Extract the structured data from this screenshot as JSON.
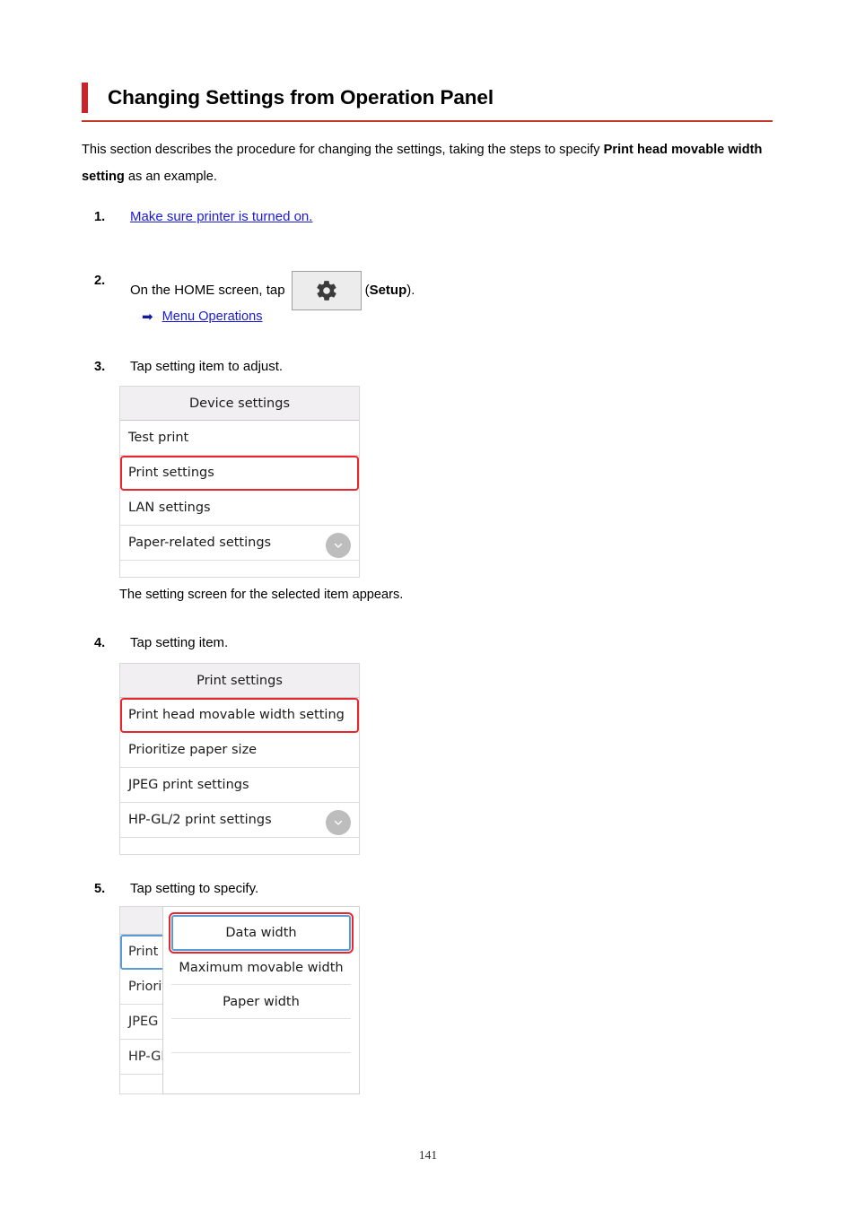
{
  "document": {
    "title": "Changing Settings from Operation Panel",
    "accent_color": "#cc2229",
    "rule_color": "#c0392b",
    "intro": {
      "part1": "This section describes the procedure for changing the settings, taking the steps to specify ",
      "bold1": "Print head movable width setting",
      "part2": " as an example."
    },
    "page_number": "141"
  },
  "steps": {
    "step1": {
      "number": "1.",
      "link_text": "Make sure printer is turned on."
    },
    "step2": {
      "number": "2.",
      "text_before": "On the HOME screen, tap",
      "icon_name": "gear-icon",
      "text_after_open": "(",
      "bold_label": "Setup",
      "text_after_close": ").",
      "sub_link": "Menu Operations",
      "sub_link_arrow": "➡"
    },
    "step3": {
      "number": "3.",
      "text": "Tap setting item to adjust.",
      "caption": "The setting screen for the selected item appears."
    },
    "step4": {
      "number": "4.",
      "text": "Tap setting item."
    },
    "step5": {
      "number": "5.",
      "text": "Tap setting to specify."
    }
  },
  "device_settings_screen": {
    "header": "Device settings",
    "items": [
      {
        "label": "Test print",
        "selected": false
      },
      {
        "label": "Print settings",
        "selected": true
      },
      {
        "label": "LAN settings",
        "selected": false
      },
      {
        "label": "Paper-related settings",
        "selected": false
      }
    ],
    "scroll_icon": "chevron-down-icon"
  },
  "print_settings_screen": {
    "header": "Print settings",
    "items": [
      {
        "label": "Print head movable width setting",
        "selected": true
      },
      {
        "label": "Prioritize paper size",
        "selected": false
      },
      {
        "label": "JPEG print settings",
        "selected": false
      },
      {
        "label": "HP-GL/2 print settings",
        "selected": false
      }
    ],
    "scroll_icon": "chevron-down-icon"
  },
  "movable_width_popup": {
    "background_items": [
      "Print h",
      "Priorit",
      "JPEG",
      "HP-GL"
    ],
    "options": [
      {
        "label": "Data width",
        "selected": true
      },
      {
        "label": "Maximum movable width",
        "selected": false
      },
      {
        "label": "Paper width",
        "selected": false
      }
    ]
  }
}
